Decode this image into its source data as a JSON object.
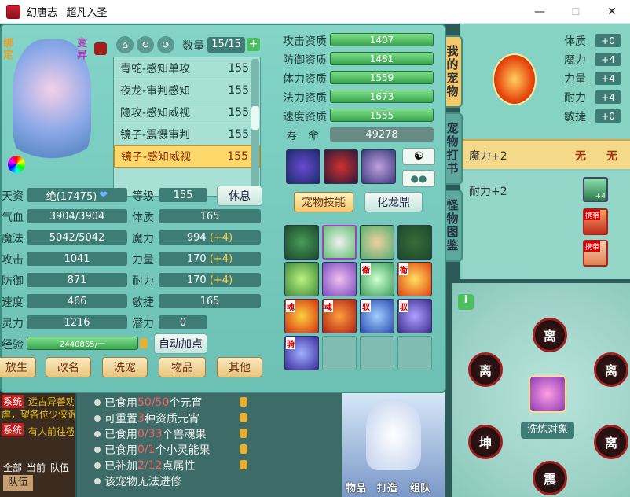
{
  "window": {
    "title": "幻唐志 - 超凡入圣",
    "min": "—",
    "max": "☐",
    "close": "✕"
  },
  "colors": {
    "accent": "#ffd86b",
    "green": "#4cbf5e",
    "gold": "#ffd54a"
  },
  "pet": {
    "bind": "绑定",
    "variant": "变异",
    "count_label": "数量",
    "count": "15/15",
    "plus": "+"
  },
  "pet_list": [
    {
      "name": "青蛇-感知单攻",
      "lv": "155"
    },
    {
      "name": "夜龙-审判感知",
      "lv": "155"
    },
    {
      "name": "隐攻-感知威视",
      "lv": "155"
    },
    {
      "name": "镜子-震慑审判",
      "lv": "155"
    },
    {
      "name": "镜子-感知威视",
      "lv": "155"
    }
  ],
  "stats": {
    "tianzi_l": "天资",
    "tianzi": "绝(17475)",
    "level_l": "等级",
    "level": "155",
    "rest": "休息",
    "hp_l": "气血",
    "hp": "3904/3904",
    "tizhi_l": "体质",
    "tizhi": "165",
    "mp_l": "魔法",
    "mp": "5042/5042",
    "moli_l": "魔力",
    "moli": "994",
    "moli_b": "(+4)",
    "atk_l": "攻击",
    "atk": "1041",
    "liliang_l": "力量",
    "liliang": "170",
    "liliang_b": "(+4)",
    "def_l": "防御",
    "def": "871",
    "naili_l": "耐力",
    "naili": "170",
    "naili_b": "(+4)",
    "spd_l": "速度",
    "spd": "466",
    "minjie_l": "敏捷",
    "minjie": "165",
    "spi_l": "灵力",
    "spi": "1216",
    "qianli_l": "潜力",
    "qianli": "0",
    "exp_l": "经验",
    "exp": "2440865/一",
    "auto": "自动加点"
  },
  "bottom_buttons": [
    "放生",
    "改名",
    "洗宠",
    "物品",
    "其他"
  ],
  "aptitude": [
    {
      "label": "攻击资质",
      "value": "1407"
    },
    {
      "label": "防御资质",
      "value": "1481"
    },
    {
      "label": "体力资质",
      "value": "1559"
    },
    {
      "label": "法力资质",
      "value": "1673"
    },
    {
      "label": "速度资质",
      "value": "1555"
    }
  ],
  "life": {
    "label": "寿　命",
    "value": "49278"
  },
  "skill_tabs": {
    "a": "宠物技能",
    "b": "化龙鼎"
  },
  "skill_tags": [
    "衛",
    "衛",
    "魂",
    "魂",
    "驭",
    "驭",
    "骑"
  ],
  "side_tabs": [
    "我的宠物",
    "宠物打书",
    "怪物图鉴"
  ],
  "right": {
    "stats": [
      {
        "l": "体质",
        "v": "+0"
      },
      {
        "l": "魔力",
        "v": "+4"
      },
      {
        "l": "力量",
        "v": "+4"
      },
      {
        "l": "耐力",
        "v": "+4"
      },
      {
        "l": "敏捷",
        "v": "+0"
      }
    ],
    "row1": "魔力+2",
    "none1": "无",
    "none2": "无",
    "row2": "耐力+2",
    "badge": "携带",
    "badge2": "携带",
    "plus4": "+4"
  },
  "tips": [
    {
      "t1": "已食用",
      "n": "50/50",
      "t2": "个元宵"
    },
    {
      "t1": "可重置",
      "n": "3",
      "t2": "种资质元宵"
    },
    {
      "t1": "已食用",
      "n": "0/33",
      "t2": "个兽魂果"
    },
    {
      "t1": "已食用",
      "n": "0/1",
      "t2": "个小灵能果"
    },
    {
      "t1": "已补加",
      "n": "2/12",
      "t2": "点属性"
    },
    {
      "t1": "该宠物无法进修",
      "n": "",
      "t2": ""
    }
  ],
  "chat": {
    "sys1": "系统",
    "line1": "远古异兽劝",
    "line2": "虐，望各位少侠诉",
    "sys2": "系统",
    "line3": "有人前往莅",
    "nav": [
      "全部",
      "当前",
      "队伍"
    ],
    "team": "队伍"
  },
  "wash": {
    "label": "洗炼对象",
    "info": "i",
    "glyphs": [
      "离",
      "离",
      "离",
      "坤",
      "离",
      "震"
    ]
  },
  "bottom_icons": [
    "物品",
    "打造",
    "组队"
  ]
}
